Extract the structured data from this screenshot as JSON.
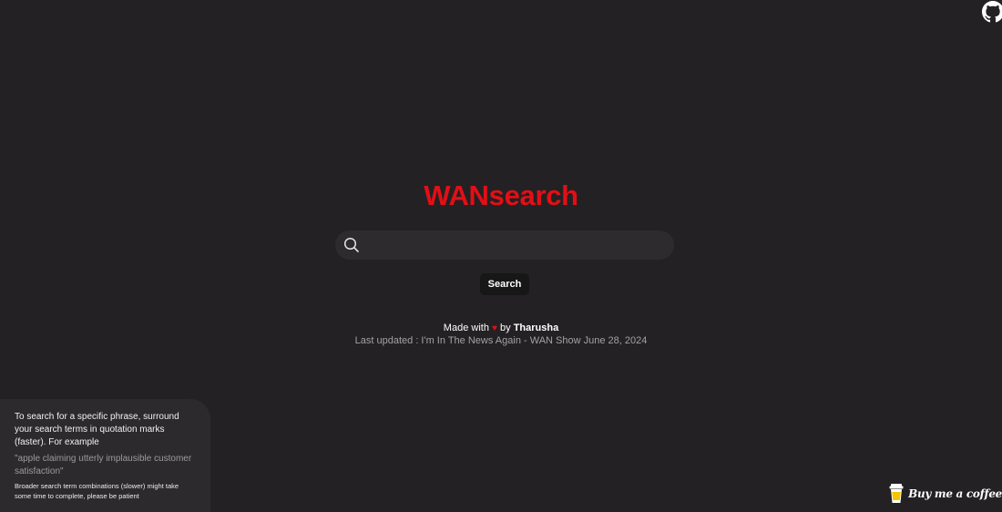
{
  "header": {
    "github_icon": "github-icon"
  },
  "brand": {
    "title": "WANsearch",
    "color": "#e20f16"
  },
  "search": {
    "value": "",
    "placeholder": "",
    "icon": "search-icon",
    "button_label": "Search"
  },
  "footer": {
    "made_with": "Made with",
    "heart": "♥",
    "by": "by",
    "author": "Tharusha",
    "last_updated": "Last updated : I'm In The News Again - WAN Show June 28, 2024"
  },
  "tips": {
    "text": "To search for a specific phrase, surround your search terms in quotation marks (faster). For example",
    "example": "\"apple claiming utterly implausible customer satisfaction\"",
    "note": "Broader search term combinations (slower) might take some time to complete, please be patient"
  },
  "donate": {
    "icon": "coffee-cup-icon",
    "label": "Buy me a coffee"
  }
}
